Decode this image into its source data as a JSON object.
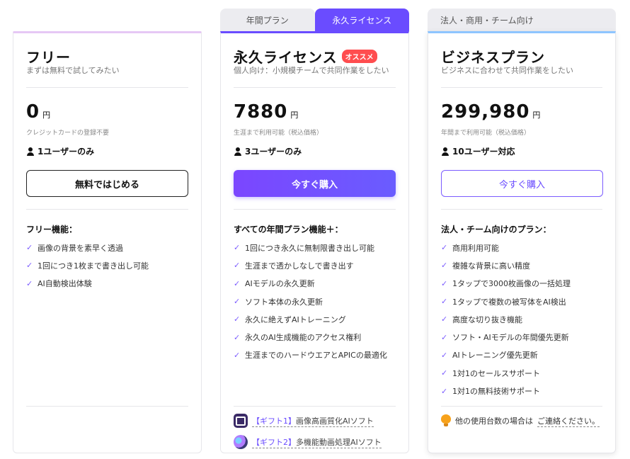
{
  "tabs": {
    "annual": "年間プラン",
    "lifetime": "永久ライセンス"
  },
  "biz_tab": "法人・商用・チーム向け",
  "free": {
    "title": "フリー",
    "subtitle": "まずは無料で試してみたい",
    "price": "0",
    "unit": "円",
    "note": "クレジットカードの登録不要",
    "users": "1ユーザーのみ",
    "button": "無料ではじめる",
    "features_title": "フリー機能：",
    "features": [
      "画像の背景を素早く透過",
      "1回につき1枚まで書き出し可能",
      "AI自動検出体験"
    ]
  },
  "lifetime": {
    "title": "永久ライセンス",
    "badge": "オススメ",
    "subtitle": "個人向け：小規模チームで共同作業をしたい",
    "price": "7880",
    "unit": "円",
    "note": "生涯まで利用可能（税込価格）",
    "users": "3ユーザーのみ",
    "button": "今すぐ購入",
    "features_title": "すべての年間プラン機能＋：",
    "features": [
      "1回につき永久に無制限書き出し可能",
      "生涯まで透かしなしで書き出す",
      "AIモデルの永久更新",
      "ソフト本体の永久更新",
      "永久に絶えずAIトレーニング",
      "永久のAI生成機能のアクセス権利",
      "生涯までのハードウエアとAPICの最適化"
    ],
    "gifts": [
      {
        "tag": "【ギフト1】",
        "text": "画像高画質化AIソフト"
      },
      {
        "tag": "【ギフト2】",
        "text": "多機能動画処理AIソフト"
      }
    ]
  },
  "business": {
    "title": "ビジネスプラン",
    "subtitle": "ビジネスに合わせて共同作業をしたい",
    "price": "299,980",
    "unit": "円",
    "note": "年間まで利用可能（税込価格）",
    "users": "10ユーザー対応",
    "button": "今すぐ購入",
    "features_title": "法人・チーム向けのプラン：",
    "features": [
      "商用利用可能",
      "複雑な背景に高い精度",
      "1タップで3000枚画像の一括処理",
      "1タップで複数の被写体をAI検出",
      "高度な切り抜き機能",
      "ソフト・AIモデルの年間優先更新",
      "AIトレーニング優先更新",
      "1対1のセールスサポート",
      "1対1の無料技術サポート"
    ],
    "contact_text": "他の使用台数の場合は",
    "contact_link": "ご連絡ください。"
  }
}
